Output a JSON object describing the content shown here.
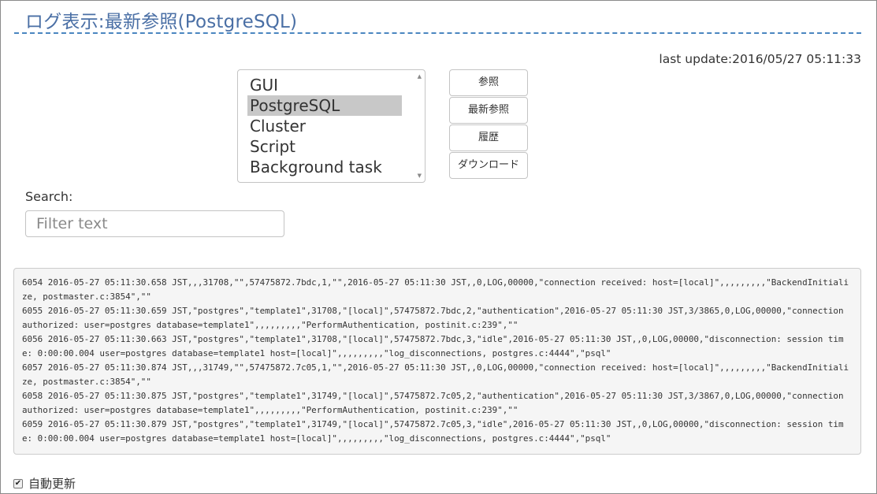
{
  "header": {
    "title": "ログ表示:最新参照(PostgreSQL)",
    "last_update": "last update:2016/05/27 05:11:33"
  },
  "log_selector": {
    "options": [
      "GUI",
      "PostgreSQL",
      "Cluster",
      "Script",
      "Background task"
    ],
    "selected": "PostgreSQL"
  },
  "buttons": {
    "browse": "参照",
    "latest": "最新参照",
    "history": "履歴",
    "download": "ダウンロード"
  },
  "search": {
    "label": "Search:",
    "placeholder": "Filter text",
    "value": ""
  },
  "log": {
    "lines": [
      "6054 2016-05-27 05:11:30.658 JST,,,31708,\"\",57475872.7bdc,1,\"\",2016-05-27 05:11:30 JST,,0,LOG,00000,\"connection received: host=[local]\",,,,,,,,,\"BackendInitialize, postmaster.c:3854\",\"\"",
      "6055 2016-05-27 05:11:30.659 JST,\"postgres\",\"template1\",31708,\"[local]\",57475872.7bdc,2,\"authentication\",2016-05-27 05:11:30 JST,3/3865,0,LOG,00000,\"connection authorized: user=postgres database=template1\",,,,,,,,,\"PerformAuthentication, postinit.c:239\",\"\"",
      "6056 2016-05-27 05:11:30.663 JST,\"postgres\",\"template1\",31708,\"[local]\",57475872.7bdc,3,\"idle\",2016-05-27 05:11:30 JST,,0,LOG,00000,\"disconnection: session time: 0:00:00.004 user=postgres database=template1 host=[local]\",,,,,,,,,\"log_disconnections, postgres.c:4444\",\"psql\"",
      "6057 2016-05-27 05:11:30.874 JST,,,31749,\"\",57475872.7c05,1,\"\",2016-05-27 05:11:30 JST,,0,LOG,00000,\"connection received: host=[local]\",,,,,,,,,\"BackendInitialize, postmaster.c:3854\",\"\"",
      "6058 2016-05-27 05:11:30.875 JST,\"postgres\",\"template1\",31749,\"[local]\",57475872.7c05,2,\"authentication\",2016-05-27 05:11:30 JST,3/3867,0,LOG,00000,\"connection authorized: user=postgres database=template1\",,,,,,,,,\"PerformAuthentication, postinit.c:239\",\"\"",
      "6059 2016-05-27 05:11:30.879 JST,\"postgres\",\"template1\",31749,\"[local]\",57475872.7c05,3,\"idle\",2016-05-27 05:11:30 JST,,0,LOG,00000,\"disconnection: session time: 0:00:00.004 user=postgres database=template1 host=[local]\",,,,,,,,,\"log_disconnections, postgres.c:4444\",\"psql\""
    ]
  },
  "footer": {
    "auto_refresh_label": "自動更新",
    "auto_refresh_checked": true
  },
  "colors": {
    "title": "#4a6fa5",
    "rule": "#4a86c0",
    "selected_option": "#c8c8c8",
    "log_background": "#f5f5f5"
  }
}
